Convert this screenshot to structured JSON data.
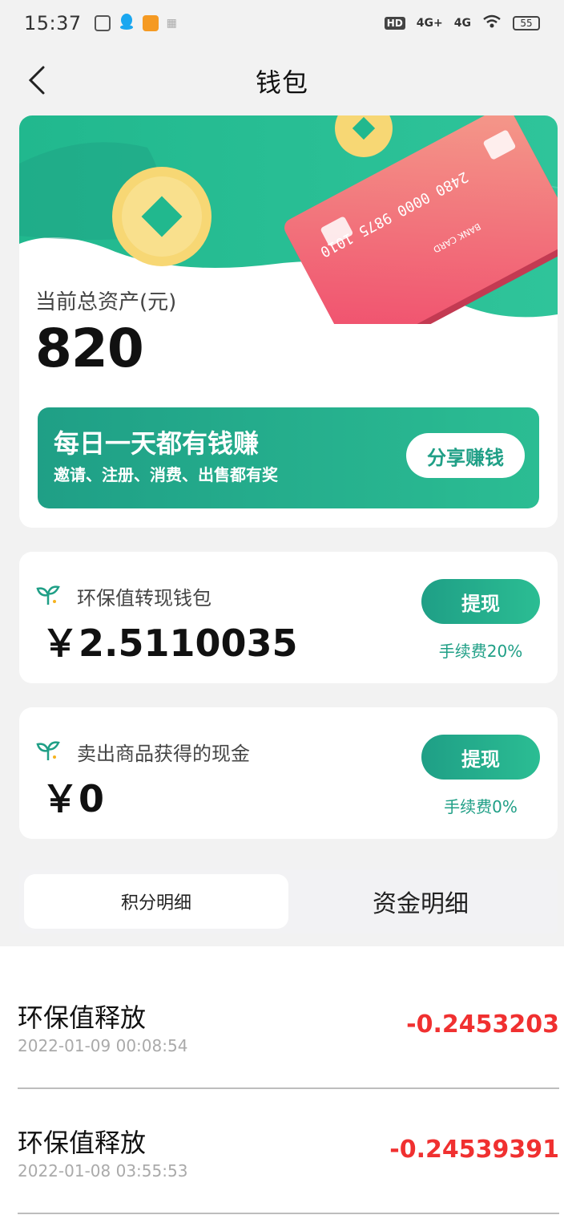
{
  "status_bar": {
    "time": "15:37",
    "network1": "4G+",
    "network2": "4G",
    "battery": "55",
    "hd_label": "HD"
  },
  "nav": {
    "title": "钱包"
  },
  "assets": {
    "label": "当前总资产(元)",
    "value": "820"
  },
  "banner_card": {
    "text_line1": "2480 0000 9875 1010",
    "text_label": "BANK CARD"
  },
  "promo": {
    "title": "每日一天都有钱赚",
    "subtitle": "邀请、注册、消费、出售都有奖",
    "button": "分享赚钱"
  },
  "wallets": [
    {
      "title": "环保值转现钱包",
      "amount": "￥2.5110035",
      "button": "提现",
      "fee": "手续费20%"
    },
    {
      "title": "卖出商品获得的现金",
      "amount": "￥0",
      "button": "提现",
      "fee": "手续费0%"
    }
  ],
  "tabs": [
    {
      "label": "积分明细",
      "active": true
    },
    {
      "label": "资金明细",
      "active": false
    }
  ],
  "records": [
    {
      "title": "环保值释放",
      "date": "2022-01-09 00:08:54",
      "amount": "-0.2453203"
    },
    {
      "title": "环保值释放",
      "date": "2022-01-08 03:55:53",
      "amount": "-0.24539391"
    }
  ],
  "colors": {
    "accent": "#1f9f86",
    "accent_light": "#2bbd93",
    "negative": "#f03030",
    "card_pink": "#f26a7a",
    "coin": "#f7d774"
  }
}
